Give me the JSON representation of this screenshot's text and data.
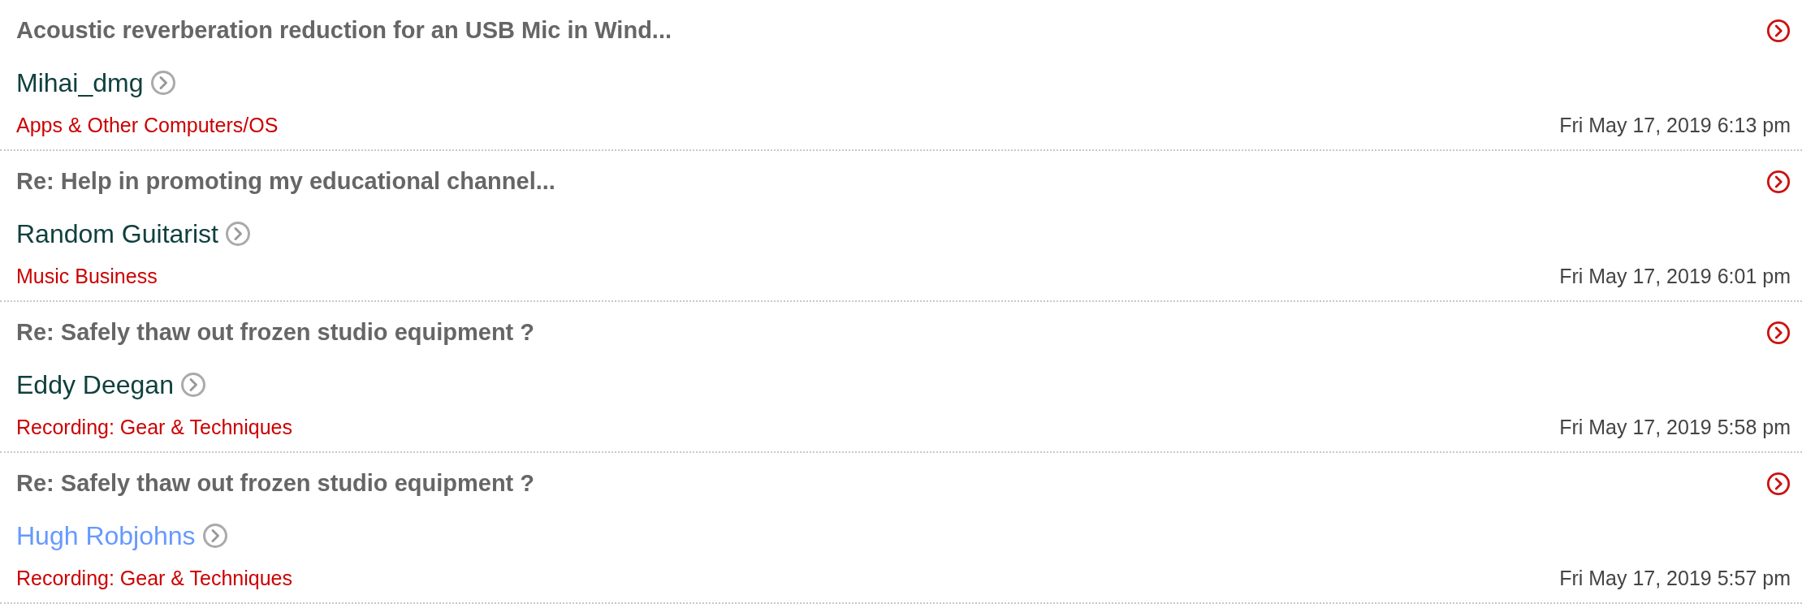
{
  "posts": [
    {
      "title": "Acoustic reverberation reduction for an USB Mic in Wind...",
      "author": {
        "name": "Mihai_dmg",
        "color": "#10403e"
      },
      "forum": "Apps & Other Computers/OS",
      "time": "Fri May 17, 2019 6:13 pm"
    },
    {
      "title": "Re: Help in promoting my educational channel...",
      "author": {
        "name": "Random Guitarist",
        "color": "#10403e"
      },
      "forum": "Music Business",
      "time": "Fri May 17, 2019 6:01 pm"
    },
    {
      "title": "Re: Safely thaw out frozen studio equipment ?",
      "author": {
        "name": "Eddy Deegan",
        "color": "#10403e"
      },
      "forum": "Recording: Gear & Techniques",
      "time": "Fri May 17, 2019 5:58 pm"
    },
    {
      "title": "Re: Safely thaw out frozen studio equipment ?",
      "author": {
        "name": "Hugh Robjohns",
        "color": "#6699ff"
      },
      "forum": "Recording: Gear & Techniques",
      "time": "Fri May 17, 2019 5:57 pm"
    }
  ]
}
